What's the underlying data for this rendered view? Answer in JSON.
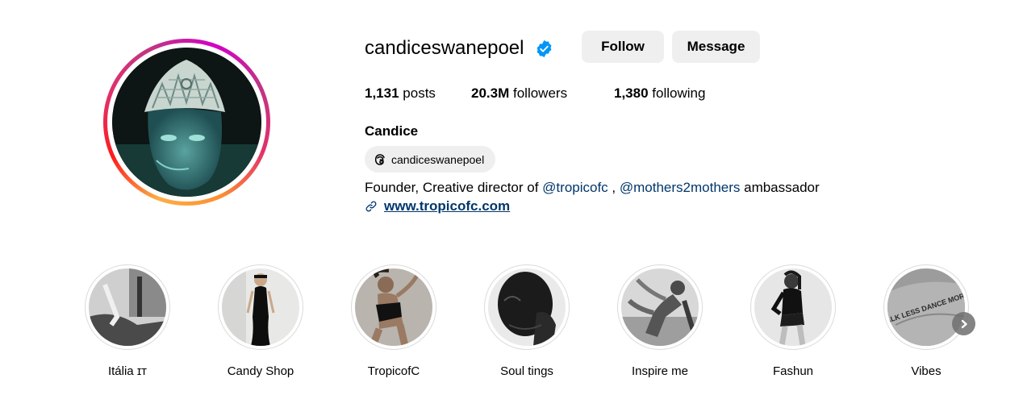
{
  "profile": {
    "username": "candiceswanepoel",
    "full_name": "Candice",
    "threads_handle": "candiceswanepoel",
    "bio": {
      "prefix": "Founder, Creative director of ",
      "mention1": "@tropicofc",
      "separator": " , ",
      "mention2": "@mothers2mothers",
      "suffix": " ambassador"
    },
    "website": "www.tropicofc.com"
  },
  "actions": {
    "follow_label": "Follow",
    "message_label": "Message"
  },
  "stats": {
    "posts_count": "1,131",
    "posts_label": "posts",
    "followers_count": "20.3M",
    "followers_label": "followers",
    "following_count": "1,380",
    "following_label": "following"
  },
  "highlights": [
    {
      "label": "Itália ɪᴛ"
    },
    {
      "label": "Candy Shop"
    },
    {
      "label": "TropicofC"
    },
    {
      "label": "Soul tings"
    },
    {
      "label": "Inspire me"
    },
    {
      "label": "Fashun"
    },
    {
      "label": "Vibes"
    }
  ],
  "highlight_image_text": {
    "vibes": "TALK LESS DANCE MORE"
  },
  "colors": {
    "verified_blue": "#0095f6",
    "link_blue": "#00376b",
    "button_bg": "#efefef"
  }
}
